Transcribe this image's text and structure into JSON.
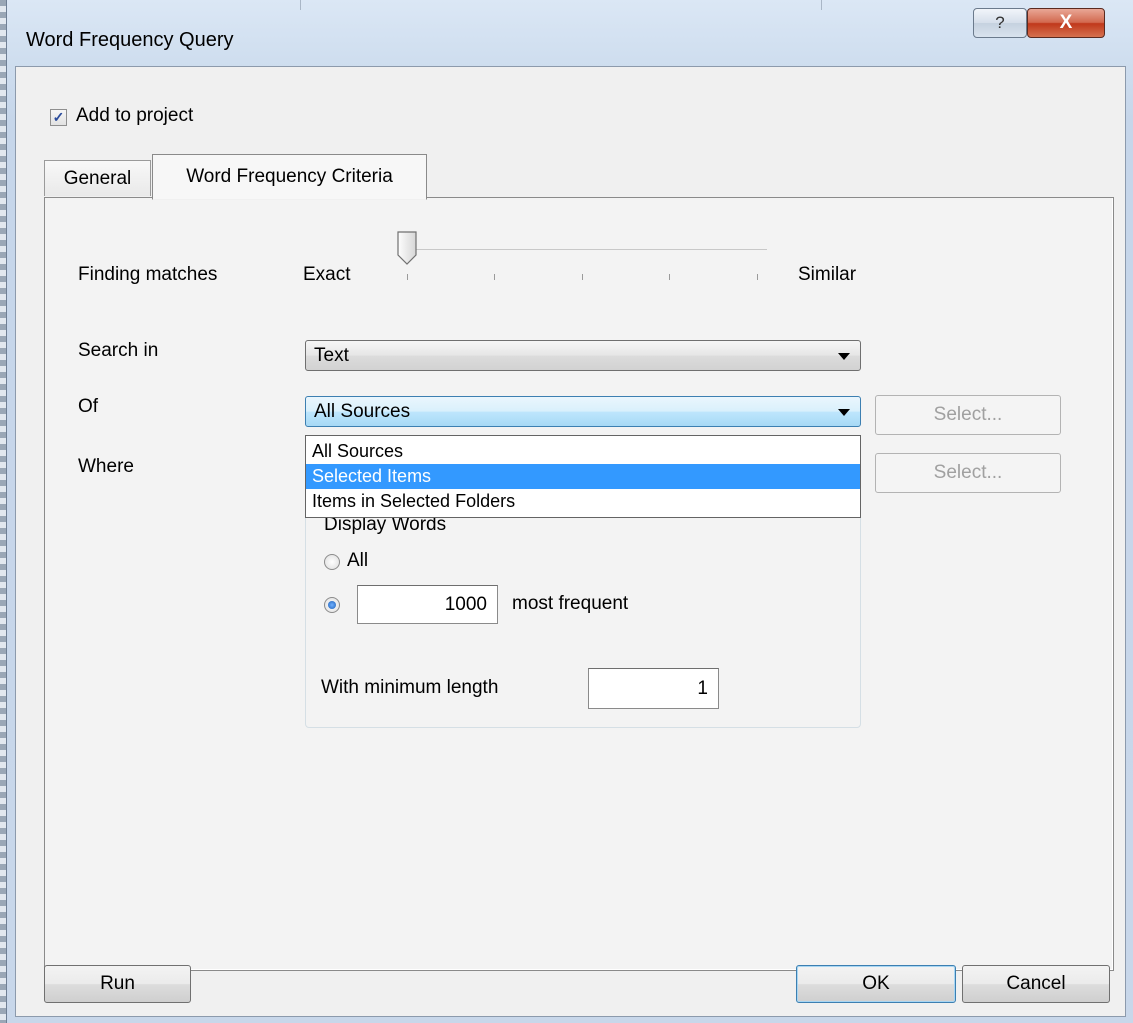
{
  "window": {
    "title": "Word Frequency Query",
    "help_glyph": "?",
    "close_glyph": "X"
  },
  "add_to_project": {
    "label": "Add to project",
    "checked": true,
    "check_glyph": "✓"
  },
  "tabs": {
    "general": "General",
    "criteria": "Word Frequency Criteria",
    "active": "Word Frequency Criteria"
  },
  "finding_matches": {
    "label": "Finding matches",
    "min_label": "Exact",
    "max_label": "Similar",
    "position": 0,
    "steps": 5
  },
  "search_in": {
    "label": "Search in",
    "value": "Text"
  },
  "of": {
    "label": "Of",
    "value": "All Sources",
    "select_button": "Select...",
    "options": [
      "All Sources",
      "Selected Items",
      "Items in Selected Folders"
    ],
    "highlighted": "Selected Items"
  },
  "where": {
    "label": "Where",
    "select_button": "Select..."
  },
  "display_words": {
    "legend": "Display Words",
    "all_label": "All",
    "most_frequent_value": "1000",
    "most_frequent_label": "most frequent",
    "selected": "most_frequent",
    "min_length_label": "With minimum length",
    "min_length_value": "1"
  },
  "buttons": {
    "run": "Run",
    "ok": "OK",
    "cancel": "Cancel"
  }
}
